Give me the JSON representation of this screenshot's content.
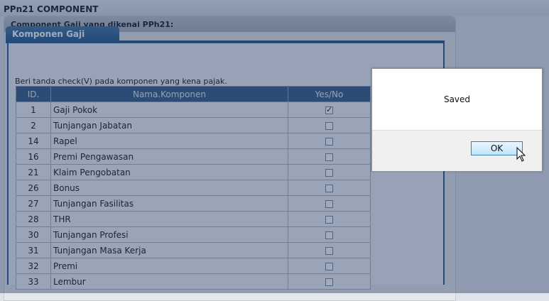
{
  "app": {
    "title": "PPn21 COMPONENT"
  },
  "panel": {
    "title": "Component Gaji yang dikenai PPh21:"
  },
  "tab": {
    "label": "Komponen Gaji"
  },
  "instruction": "Beri tanda check(V) pada komponen yang kena pajak.",
  "table": {
    "headers": {
      "id": "ID.",
      "name": "Nama.Komponen",
      "yesno": "Yes/No"
    },
    "rows": [
      {
        "id": "1",
        "name": "Gaji Pokok",
        "checked": true
      },
      {
        "id": "2",
        "name": "Tunjangan Jabatan",
        "checked": false
      },
      {
        "id": "14",
        "name": "Rapel",
        "checked": false
      },
      {
        "id": "16",
        "name": "Premi Pengawasan",
        "checked": false
      },
      {
        "id": "21",
        "name": "Klaim Pengobatan",
        "checked": false
      },
      {
        "id": "26",
        "name": "Bonus",
        "checked": false
      },
      {
        "id": "27",
        "name": "Tunjangan Fasilitas",
        "checked": false
      },
      {
        "id": "28",
        "name": "THR",
        "checked": false
      },
      {
        "id": "30",
        "name": "Tunjangan Profesi",
        "checked": false
      },
      {
        "id": "31",
        "name": "Tunjangan Masa Kerja",
        "checked": false
      },
      {
        "id": "32",
        "name": "Premi",
        "checked": false
      },
      {
        "id": "33",
        "name": "Lembur",
        "checked": false
      }
    ]
  },
  "dialog": {
    "message": "Saved",
    "ok_label": "OK"
  }
}
